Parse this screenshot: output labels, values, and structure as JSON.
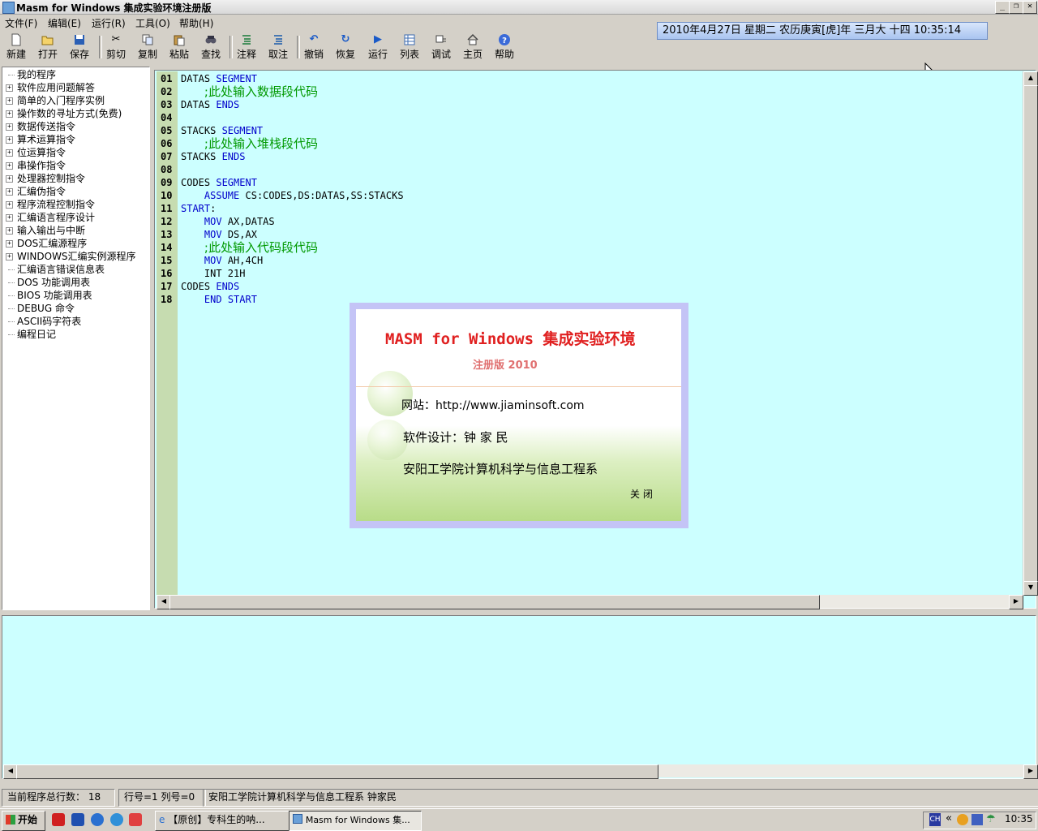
{
  "window": {
    "title": "Masm for Windows 集成实验环境注册版"
  },
  "menu": [
    "文件(F)",
    "编辑(E)",
    "运行(R)",
    "工具(O)",
    "帮助(H)"
  ],
  "datetime": "2010年4月27日 星期二 农历庚寅[虎]年 三月大 十四 10:35:14",
  "toolbar": [
    {
      "label": "新建",
      "icon": "new-file-icon"
    },
    {
      "label": "打开",
      "icon": "open-folder-icon"
    },
    {
      "label": "保存",
      "icon": "save-icon"
    },
    {
      "label": "剪切",
      "icon": "cut-icon"
    },
    {
      "label": "复制",
      "icon": "copy-icon"
    },
    {
      "label": "粘贴",
      "icon": "paste-icon"
    },
    {
      "label": "查找",
      "icon": "find-icon"
    },
    {
      "label": "注释",
      "icon": "comment-icon"
    },
    {
      "label": "取注",
      "icon": "uncomment-icon"
    },
    {
      "label": "撤销",
      "icon": "undo-icon"
    },
    {
      "label": "恢复",
      "icon": "redo-icon"
    },
    {
      "label": "运行",
      "icon": "run-icon"
    },
    {
      "label": "列表",
      "icon": "list-icon"
    },
    {
      "label": "调试",
      "icon": "debug-icon"
    },
    {
      "label": "主页",
      "icon": "home-icon"
    },
    {
      "label": "帮助",
      "icon": "help-icon"
    }
  ],
  "tree": [
    {
      "label": "我的程序",
      "expandable": false
    },
    {
      "label": "软件应用问题解答",
      "expandable": true
    },
    {
      "label": "简单的入门程序实例",
      "expandable": true
    },
    {
      "label": "操作数的寻址方式(免费)",
      "expandable": true
    },
    {
      "label": "数据传送指令",
      "expandable": true
    },
    {
      "label": "算术运算指令",
      "expandable": true
    },
    {
      "label": "位运算指令",
      "expandable": true
    },
    {
      "label": "串操作指令",
      "expandable": true
    },
    {
      "label": "处理器控制指令",
      "expandable": true
    },
    {
      "label": "汇编伪指令",
      "expandable": true
    },
    {
      "label": "程序流程控制指令",
      "expandable": true
    },
    {
      "label": "汇编语言程序设计",
      "expandable": true
    },
    {
      "label": "输入输出与中断",
      "expandable": true
    },
    {
      "label": "DOS汇编源程序",
      "expandable": true
    },
    {
      "label": "WINDOWS汇编实例源程序",
      "expandable": true
    },
    {
      "label": "汇编语言错误信息表",
      "expandable": false
    },
    {
      "label": "DOS 功能调用表",
      "expandable": false
    },
    {
      "label": "BIOS 功能调用表",
      "expandable": false
    },
    {
      "label": "DEBUG 命令",
      "expandable": false
    },
    {
      "label": "ASCII码字符表",
      "expandable": false
    },
    {
      "label": "编程日记",
      "expandable": false
    }
  ],
  "editor": {
    "lines": [
      {
        "num": "01",
        "tokens": [
          [
            "t",
            "DATAS "
          ],
          [
            "k",
            "SEGMENT"
          ]
        ]
      },
      {
        "num": "02",
        "tokens": [
          [
            "t",
            "    "
          ],
          [
            "c",
            ";此处输入数据段代码"
          ]
        ]
      },
      {
        "num": "03",
        "tokens": [
          [
            "t",
            "DATAS "
          ],
          [
            "k",
            "ENDS"
          ]
        ]
      },
      {
        "num": "04",
        "tokens": []
      },
      {
        "num": "05",
        "tokens": [
          [
            "t",
            "STACKS "
          ],
          [
            "k",
            "SEGMENT"
          ]
        ]
      },
      {
        "num": "06",
        "tokens": [
          [
            "t",
            "    "
          ],
          [
            "c",
            ";此处输入堆栈段代码"
          ]
        ]
      },
      {
        "num": "07",
        "tokens": [
          [
            "t",
            "STACKS "
          ],
          [
            "k",
            "ENDS"
          ]
        ]
      },
      {
        "num": "08",
        "tokens": []
      },
      {
        "num": "09",
        "tokens": [
          [
            "t",
            "CODES "
          ],
          [
            "k",
            "SEGMENT"
          ]
        ]
      },
      {
        "num": "10",
        "tokens": [
          [
            "t",
            "    "
          ],
          [
            "k",
            "ASSUME"
          ],
          [
            "t",
            " CS:CODES,DS:DATAS,SS:STACKS"
          ]
        ]
      },
      {
        "num": "11",
        "tokens": [
          [
            "k",
            "START"
          ],
          [
            "t",
            ":"
          ]
        ]
      },
      {
        "num": "12",
        "tokens": [
          [
            "t",
            "    "
          ],
          [
            "k",
            "MOV"
          ],
          [
            "t",
            " AX,DATAS"
          ]
        ]
      },
      {
        "num": "13",
        "tokens": [
          [
            "t",
            "    "
          ],
          [
            "k",
            "MOV"
          ],
          [
            "t",
            " DS,AX"
          ]
        ]
      },
      {
        "num": "14",
        "tokens": [
          [
            "t",
            "    "
          ],
          [
            "c",
            ";此处输入代码段代码"
          ]
        ]
      },
      {
        "num": "15",
        "tokens": [
          [
            "t",
            "    "
          ],
          [
            "k",
            "MOV"
          ],
          [
            "t",
            " AH,4CH"
          ]
        ]
      },
      {
        "num": "16",
        "tokens": [
          [
            "t",
            "    INT 21H"
          ]
        ]
      },
      {
        "num": "17",
        "tokens": [
          [
            "t",
            "CODES "
          ],
          [
            "k",
            "ENDS"
          ]
        ]
      },
      {
        "num": "18",
        "tokens": [
          [
            "t",
            "    "
          ],
          [
            "k",
            "END"
          ],
          [
            "t",
            " "
          ],
          [
            "k",
            "START"
          ]
        ]
      }
    ]
  },
  "splash": {
    "title": "MASM for Windows 集成实验环境",
    "edition": "注册版 2010",
    "website": "网站：http://www.jiaminsoft.com",
    "designer": "软件设计：钟 家 民",
    "org": "安阳工学院计算机科学与信息工程系",
    "close_label": "关 闭"
  },
  "status": {
    "line_count": "当前程序总行数： 18",
    "position": "行号=1  列号=0",
    "author": "安阳工学院计算机科学与信息工程系  钟家民"
  },
  "taskbar": {
    "start_label": "开始",
    "tasks": [
      "【原创】专科生的呐...",
      "Masm for Windows 集..."
    ],
    "ime": "CH",
    "clock": "10:35"
  }
}
